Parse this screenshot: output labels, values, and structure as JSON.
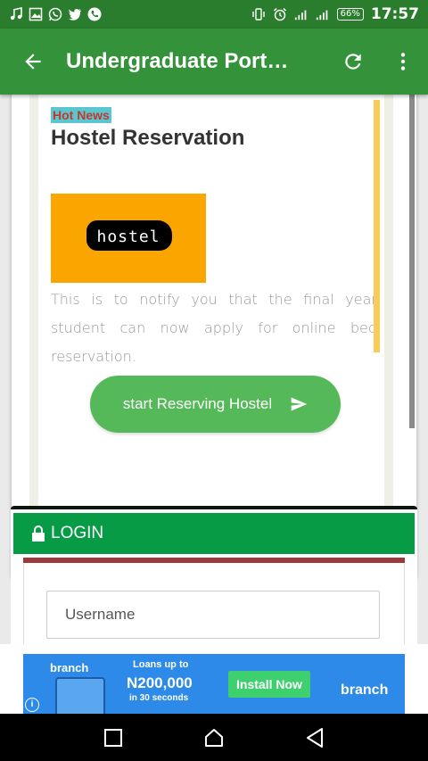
{
  "status_bar": {
    "time": "17:57",
    "battery": "66%",
    "left_icons": [
      "music-icon",
      "image-icon",
      "whatsapp-icon",
      "twitter-icon",
      "phone-icon"
    ],
    "right_icons": [
      "vibrate-icon",
      "alarm-icon",
      "signal-icon",
      "signal-icon",
      "battery-icon"
    ]
  },
  "app_bar": {
    "title": "Undergraduate Port…",
    "back_icon": "arrow-left-icon",
    "refresh_icon": "refresh-icon",
    "menu_icon": "more-vert-icon"
  },
  "news": {
    "badge": "Hot News",
    "title": "Hostel Reservation",
    "image_text": "hostel",
    "body": "This is to notify you that the final year student can now apply for online bed reservation.",
    "button_label": "start Reserving Hostel",
    "button_icon": "send-icon"
  },
  "login": {
    "header": "LOGIN",
    "lock_icon": "lock-icon",
    "username_placeholder": "Username"
  },
  "ad": {
    "logo": "branch",
    "line1": "Loans up to",
    "line2": "N200,000",
    "line3": "in 30 seconds",
    "install": "Install Now",
    "brand": "branch",
    "info": "i"
  },
  "nav": {
    "recent_icon": "square-icon",
    "home_icon": "home-icon",
    "back_icon": "triangle-back-icon"
  },
  "colors": {
    "status_bar": "#2a7d2c",
    "app_bar": "#33923a",
    "login_header": "#089b46",
    "button": "#55b95a",
    "image_bg": "#fba600",
    "ad_bg": "#2d8ae8"
  }
}
